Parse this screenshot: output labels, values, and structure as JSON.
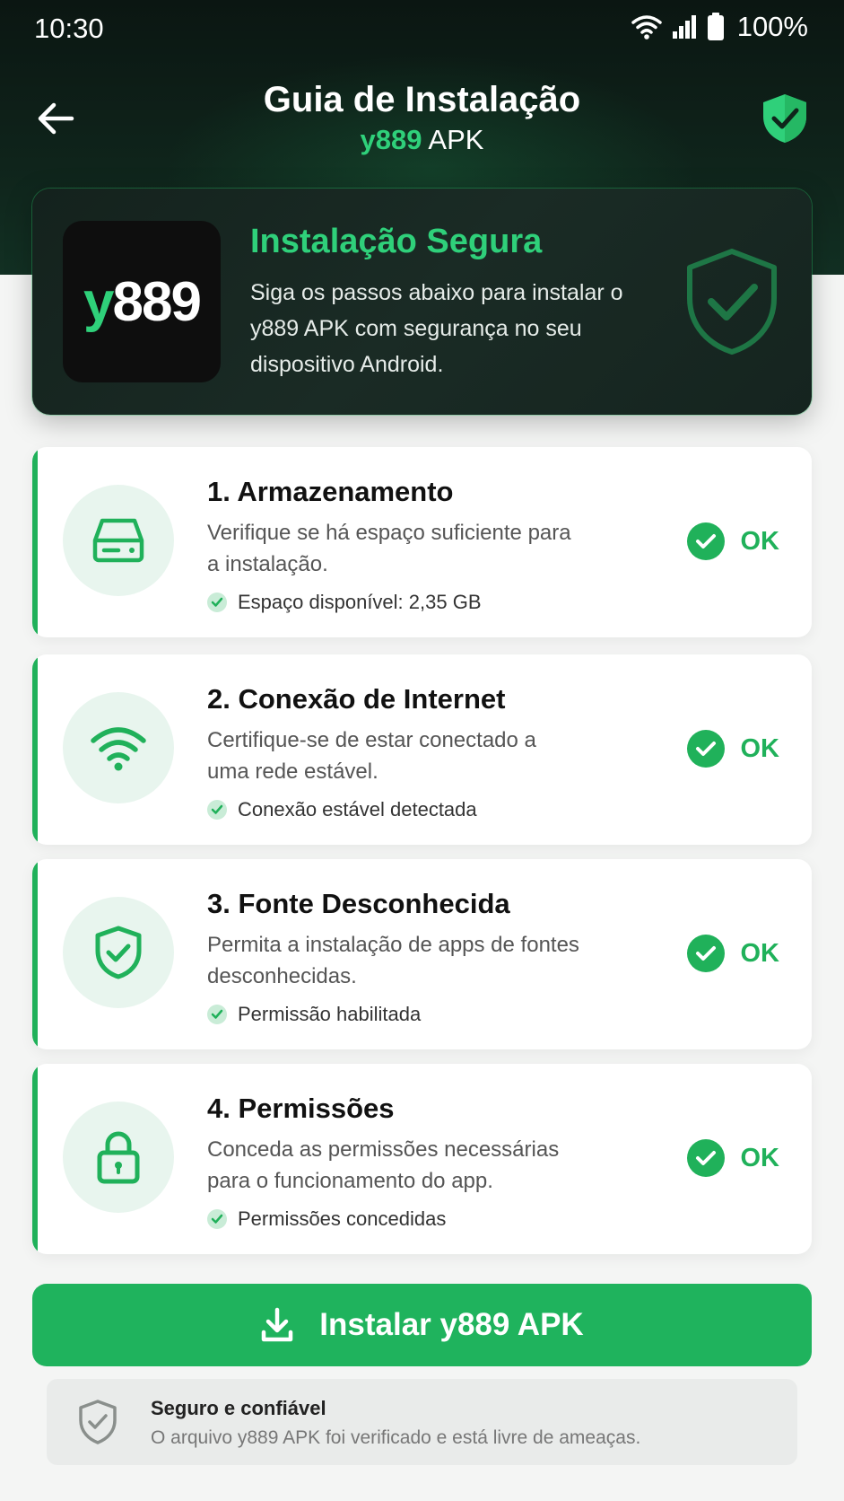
{
  "status_bar": {
    "time": "10:30",
    "battery": "100%",
    "icons": [
      "wifi-icon",
      "signal-icon",
      "battery-icon"
    ]
  },
  "header": {
    "back_icon": "arrow-left-icon",
    "title": "Guia de Instalação",
    "subtitle_accent": "y889",
    "subtitle_rest": " APK",
    "shield_icon": "shield-check-icon"
  },
  "hero": {
    "logo_accent": "y",
    "logo_rest": "889",
    "title": "Instalação Segura",
    "description": "Siga os passos abaixo para instalar o y889 APK com segurança no seu dispositivo Android."
  },
  "steps": [
    {
      "icon": "storage-icon",
      "title": "1. Armazenamento",
      "description": "Verifique se há espaço suficiente para a instalação.",
      "check": "Espaço disponível: 2,35 GB",
      "status": "OK"
    },
    {
      "icon": "wifi-icon",
      "title": "2. Conexão de Internet",
      "description": "Certifique-se de estar conectado a uma rede estável.",
      "check": "Conexão estável detectada",
      "status": "OK"
    },
    {
      "icon": "shield-check-icon",
      "title": "3. Fonte Desconhecida",
      "description": "Permita a instalação de apps de fontes desconhecidas.",
      "check": "Permissão habilitada",
      "status": "OK"
    },
    {
      "icon": "lock-icon",
      "title": "4. Permissões",
      "description": "Conceda as permissões necessárias para o funcionamento do app.",
      "check": "Permissões concedidas",
      "status": "OK"
    }
  ],
  "install_button": {
    "icon": "download-icon",
    "label": "Instalar y889 APK"
  },
  "trust_note": {
    "icon": "shield-check-icon",
    "title": "Seguro e confiável",
    "description": "O arquivo y889 APK foi verificado e está livre de ameaças."
  },
  "colors": {
    "accent": "#1fb35d",
    "accent_light": "#2fd07a",
    "header_dark": "#0f241b"
  }
}
